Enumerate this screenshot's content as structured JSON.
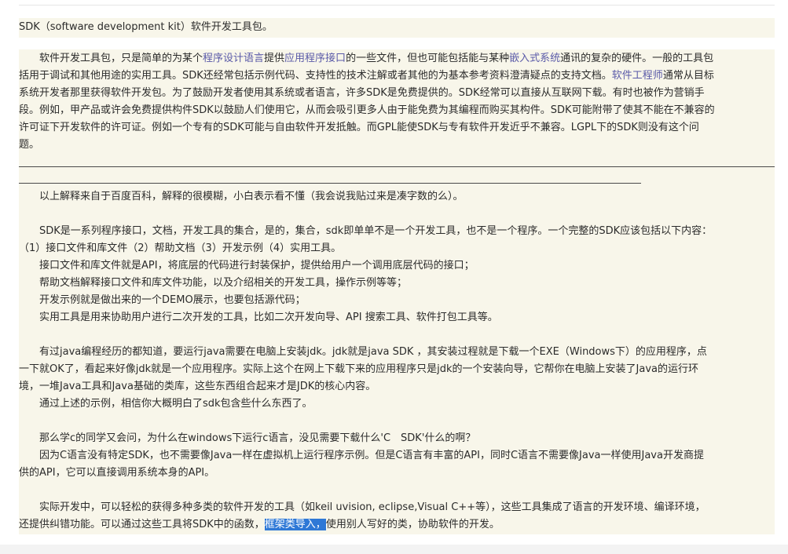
{
  "header_line": "SDK（software development kit）软件开发工具包。",
  "para1": {
    "l1_a": "　　软件开发工具包，只是简单的为某个",
    "l1_link1": "程序设计语言",
    "l1_b": "提供",
    "l1_link2": "应用程序接口",
    "l1_c": "的一些文件，但也可能包括能与某种",
    "l1_link3": "嵌入式系统",
    "l1_d": "通讯的复杂的硬件。一般的工具包",
    "l2_a": "括用于调试和其他用途的实用工具。SDK还经常包括示例代码、支持性的技术注解或者其他的为基本参考资料澄清疑点的支持文档。",
    "l2_link": "软件工程师",
    "l2_b": "通常从目标",
    "l3": "系统开发者那里获得软件开发包。为了鼓励开发者使用其系统或者语言，许多SDK是免费提供的。SDK经常可以直接从互联网下载。有时也被作为营销手",
    "l4": "段。例如，甲产品或许会免费提供构件SDK以鼓励人们使用它，从而会吸引更多人由于能免费为其编程而购买其构件。SDK可能附带了使其不能在不兼容的",
    "l5": "许可证下开发软件的许可证。例如一个专有的SDK可能与自由软件开发抵触。而GPL能使SDK与专有软件开发近乎不兼容。LGPL下的SDK则没有这个问",
    "l6": "题。"
  },
  "body": {
    "note": "　　以上解释来自于百度百科，解释的很模糊，小白表示看不懂（我会说我贴过来是凑字数的么）。",
    "s1_l1": "　　SDK是一系列程序接口，文档，开发工具的集合，是的，集合，sdk即单单不是一个开发工具，也不是一个程序。一个完整的SDK应该包括以下内容：",
    "s1_l2": "（1）接口文件和库文件（2）帮助文档（3）开发示例（4）实用工具。",
    "s1_l3": "　　接口文件和库文件就是API，将底层的代码进行封装保护，提供给用户一个调用底层代码的接口；",
    "s1_l4": "　　帮助文档解释接口文件和库文件功能，以及介绍相关的开发工具，操作示例等等；",
    "s1_l5": "　　开发示例就是做出来的一个DEMO展示，也要包括源代码；",
    "s1_l6": "　　实用工具是用来协助用户进行二次开发的工具，比如二次开发向导、API 搜索工具、软件打包工具等。",
    "s2_l1": "　　有过java编程经历的都知道，要运行java需要在电脑上安装jdk。jdk就是java SDK ，其安装过程就是下载一个EXE（Windows下）的应用程序，点",
    "s2_l2": "一下就OK了，看起来好像jdk就是一个应用程序。实际上这个在网上下载下来的应用程序只是jdk的一个安装向导，它帮你在电脑上安装了Java的运行环",
    "s2_l3": "境，一堆Java工具和Java基础的类库，这些东西组合起来才是JDK的核心内容。",
    "s2_l4": "　　通过上述的示例，相信你大概明白了sdk包含些什么东西了。",
    "s3_l1": "　　那么学c的同学又会问，为什么在windows下运行c语言，没见需要下载什么'C　SDK'什么的啊？",
    "s3_l2": "　　因为C语言没有特定SDK，也不需要像Java一样在虚拟机上运行程序示例。但是C语言有丰富的API，同时C语言不需要像Java一样使用Java开发商提",
    "s3_l3": "供的API，它可以直接调用系统本身的API。",
    "s4_l1": "　　实际开发中，可以轻松的获得多种多类的软件开发的工具（如keil uvision, eclipse,Visual C++等），这些工具集成了语言的开发环境、编译环境，",
    "s4_l2_a": "还提供纠错功能。可以通过这些工具将SDK中的函数，",
    "s4_l2_hl": "框架类导入，",
    "s4_l2_b": "使用别人写好的类，协助软件的开发。"
  },
  "colors": {
    "box_bg": "#f8f6ea",
    "link": "#5a5aa8",
    "highlight": "#2e78d6"
  }
}
